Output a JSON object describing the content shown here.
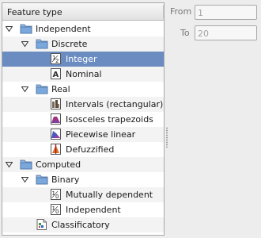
{
  "tree": {
    "header": "Feature type",
    "rows": [
      {
        "label": "Independent",
        "icon": "folder-open-icon",
        "expanded": true
      },
      {
        "label": "Discrete",
        "icon": "folder-open-icon",
        "expanded": true
      },
      {
        "label": "Integer",
        "icon": "integer-feature-icon",
        "selected": true
      },
      {
        "label": "Nominal",
        "icon": "nominal-feature-icon"
      },
      {
        "label": "Real",
        "icon": "folder-open-icon",
        "expanded": true
      },
      {
        "label": "Intervals (rectangular)",
        "icon": "intervals-feature-icon"
      },
      {
        "label": "Isosceles trapezoids",
        "icon": "trapezoid-feature-icon"
      },
      {
        "label": "Piecewise linear",
        "icon": "piecewise-linear-feature-icon"
      },
      {
        "label": "Defuzzified",
        "icon": "defuzzified-feature-icon"
      },
      {
        "label": "Computed",
        "icon": "folder-open-icon",
        "expanded": true
      },
      {
        "label": "Binary",
        "icon": "folder-open-icon",
        "expanded": true
      },
      {
        "label": "Mutually dependent",
        "icon": "binary-feature-icon"
      },
      {
        "label": "Independent",
        "icon": "binary-feature-icon"
      },
      {
        "label": "Classificatory",
        "icon": "classificatory-feature-icon"
      }
    ]
  },
  "range": {
    "from_label": "From",
    "from_value": "1",
    "to_label": "To",
    "to_value": "20"
  },
  "colors": {
    "selection": "#6a8cc1",
    "folder": "#7aa7dc"
  }
}
